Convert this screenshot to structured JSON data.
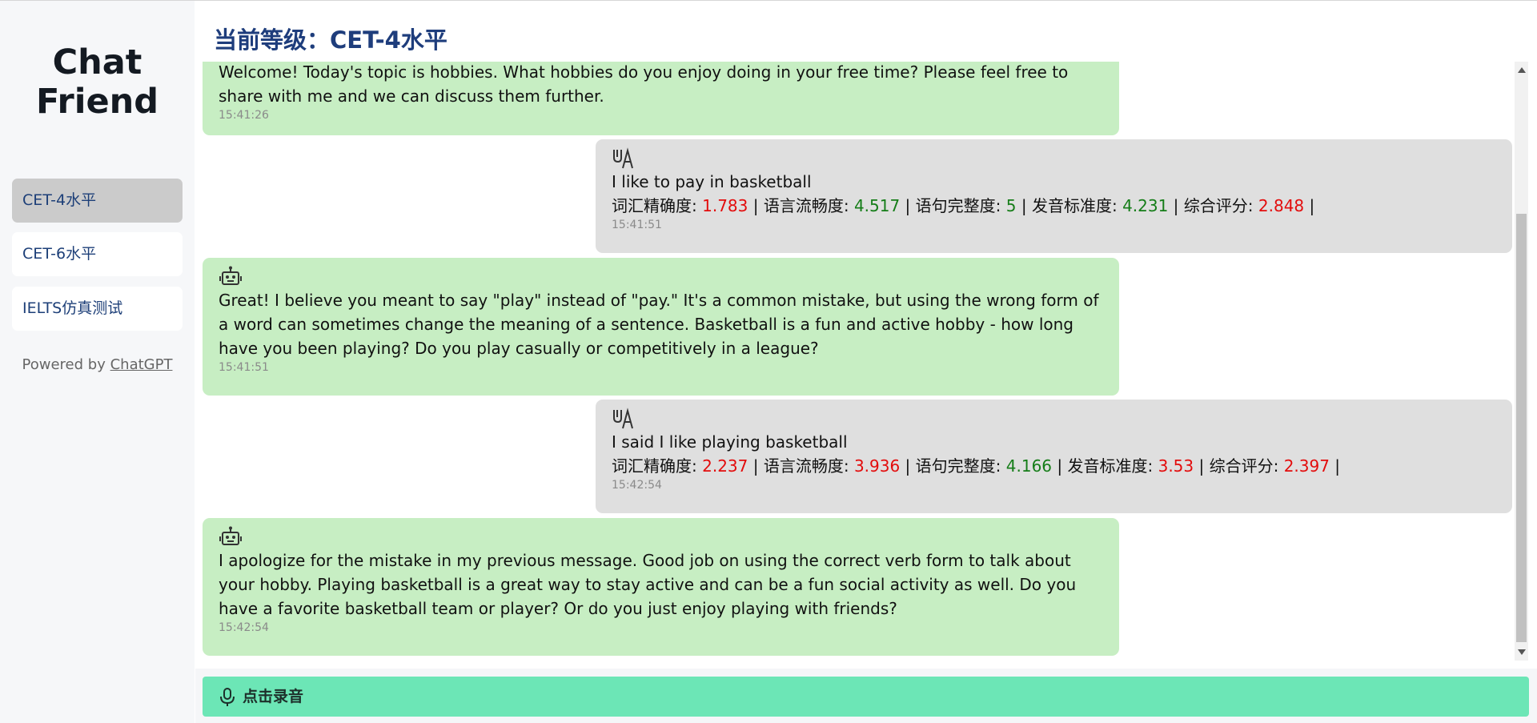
{
  "sidebar": {
    "logo_line1": "Chat",
    "logo_line2": "Friend",
    "items": [
      {
        "label": "CET-4水平"
      },
      {
        "label": "CET-6水平"
      },
      {
        "label": "IELTS仿真测试"
      }
    ],
    "powered_prefix": "Powered by",
    "powered_link": "ChatGPT"
  },
  "header": {
    "title": "当前等级：CET-4水平"
  },
  "messages": [
    {
      "role": "bot",
      "text": "Welcome! Today's topic is hobbies. What hobbies do you enjoy doing in your free time? Please feel free to share with me and we can discuss them further.",
      "time": "15:41:26"
    },
    {
      "role": "user",
      "text": "I like to pay in basketball",
      "time": "15:41:51",
      "scores": {
        "vocab_label": "词汇精确度:",
        "vocab": "1.783",
        "vocab_color": "#e30c0c",
        "fluency_label": "语言流畅度:",
        "fluency": "4.517",
        "fluency_color": "#157d18",
        "complete_label": "语句完整度:",
        "complete": "5",
        "complete_color": "#157d18",
        "pron_label": "发音标准度:",
        "pron": "4.231",
        "pron_color": "#157d18",
        "total_label": "综合评分:",
        "total": "2.848",
        "total_color": "#e30c0c"
      }
    },
    {
      "role": "bot",
      "text": "Great! I believe you meant to say \"play\" instead of \"pay.\" It's a common mistake, but using the wrong form of a word can sometimes change the meaning of a sentence. Basketball is a fun and active hobby - how long have you been playing? Do you play casually or competitively in a league?",
      "time": "15:41:51"
    },
    {
      "role": "user",
      "text": "I said I like playing basketball",
      "time": "15:42:54",
      "scores": {
        "vocab_label": "词汇精确度:",
        "vocab": "2.237",
        "vocab_color": "#e30c0c",
        "fluency_label": "语言流畅度:",
        "fluency": "3.936",
        "fluency_color": "#e30c0c",
        "complete_label": "语句完整度:",
        "complete": "4.166",
        "complete_color": "#157d18",
        "pron_label": "发音标准度:",
        "pron": "3.53",
        "pron_color": "#e30c0c",
        "total_label": "综合评分:",
        "total": "2.397",
        "total_color": "#e30c0c"
      }
    },
    {
      "role": "bot",
      "text": "I apologize for the mistake in my previous message. Good job on using the correct verb form to talk about your hobby. Playing basketball is a great way to stay active and can be a fun social activity as well. Do you have a favorite basketball team or player? Or do you just enjoy playing with friends?",
      "time": "15:42:54"
    }
  ],
  "record_button": {
    "label": "点击录音"
  },
  "icons": {
    "user": "voice-translate-icon",
    "bot": "robot-icon",
    "record": "microphone-icon"
  },
  "colors": {
    "accent": "#6ce6b6",
    "bot_bubble": "#c7eec3",
    "user_bubble": "#dfdfdf",
    "title": "#1e3d7c",
    "good_score": "#157d18",
    "bad_score": "#e30c0c"
  }
}
